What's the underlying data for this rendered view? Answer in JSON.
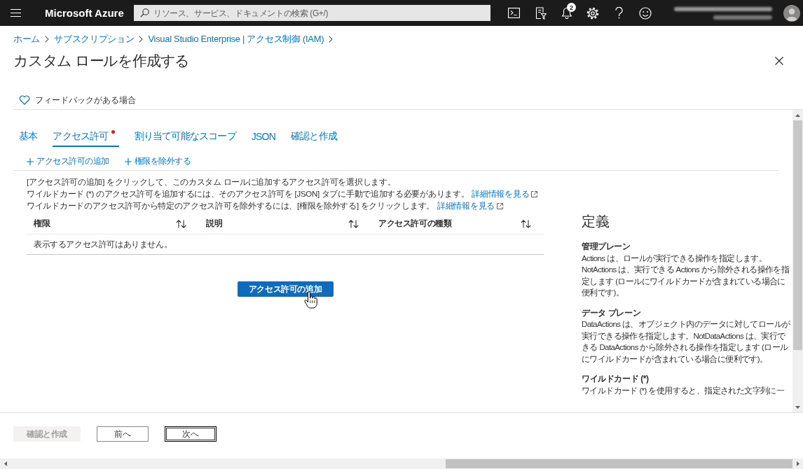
{
  "top_bar": {
    "brand": "Microsoft Azure",
    "search": {
      "placeholder": "リソース、サービス、ドキュメントの検索 (G+/)"
    },
    "notification_count": "2"
  },
  "breadcrumb": [
    "ホーム",
    "サブスクリプション",
    "Visual Studio Enterprise | アクセス制御 (IAM)"
  ],
  "title": "カスタム ロールを作成する",
  "feedback": "フィードバックがある場合",
  "tabs": [
    {
      "label": "基本",
      "selected": false,
      "has_error": false
    },
    {
      "label": "アクセス許可",
      "selected": true,
      "has_error": true
    },
    {
      "label": "割り当て可能なスコープ",
      "selected": false,
      "has_error": false
    },
    {
      "label": "JSON",
      "selected": false,
      "has_error": false
    },
    {
      "label": "確認と作成",
      "selected": false,
      "has_error": false
    }
  ],
  "toolbar": [
    "アクセス許可の追加",
    "権限を除外する"
  ],
  "instructions": [
    {
      "text": "[アクセス許可の追加] をクリックして、このカスタム ロールに追加するアクセス許可を選択します。"
    },
    {
      "text": "ワイルドカード (*) のアクセス許可を追加するには、そのアクセス許可を [JSON] タブに手動で追加する必要があります。",
      "link": "詳細情報を見る"
    },
    {
      "text": "ワイルドカードのアクセス許可から特定のアクセス許可を除外するには、[権限を除外する] をクリックします。",
      "link": "詳細情報を見る"
    }
  ],
  "table": {
    "columns": [
      "権限",
      "説明",
      "アクセス許可の種類"
    ],
    "empty_message": "表示するアクセス許可はありません。"
  },
  "add_button": "アクセス許可の追加",
  "definitions": {
    "title": "定義",
    "sections": [
      {
        "heading": "管理プレーン",
        "body": "Actions は、ロールが実行できる操作を指定します。NotActions は、実行できる Actions から除外される操作を指定します (ロールにワイルドカードが含まれている場合に便利です)。"
      },
      {
        "heading": "データ プレーン",
        "body": "DataActions は、オブジェクト内のデータに対してロールが実行できる操作を指定します。NotDataActions は、実行できる DataActions から除外される操作を指定します (ロールにワイルドカードが含まれている場合に便利です)。"
      },
      {
        "heading": "ワイルドカード (*)",
        "body": "ワイルドカード (*) を使用すると、指定された文字列に一"
      }
    ]
  },
  "footer": {
    "buttons": [
      {
        "label": "確認と作成",
        "disabled": true,
        "focused": false
      },
      {
        "label": "前へ",
        "disabled": false,
        "focused": false
      },
      {
        "label": "次へ",
        "disabled": false,
        "focused": true
      }
    ]
  }
}
